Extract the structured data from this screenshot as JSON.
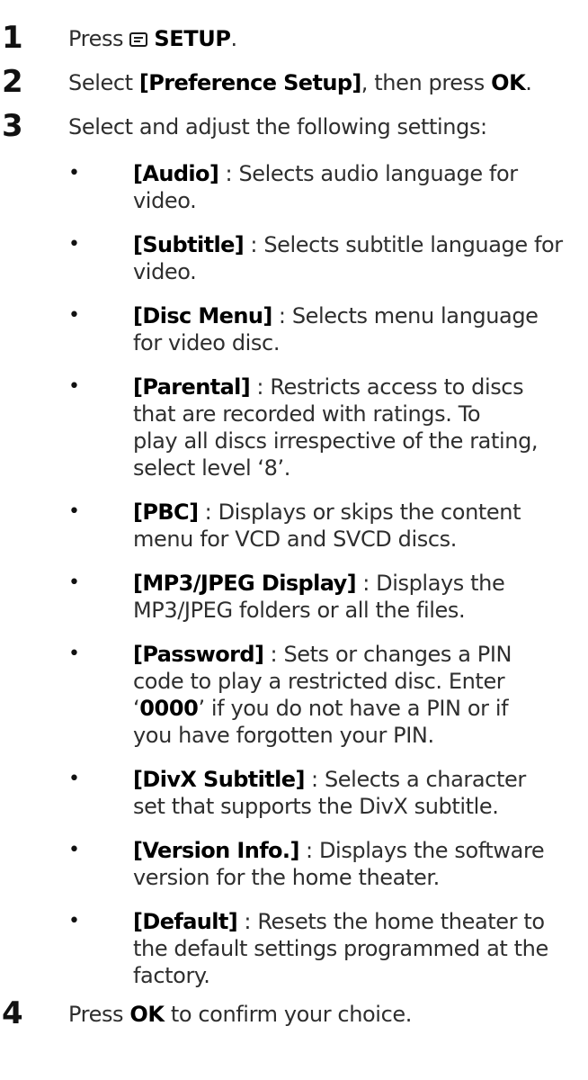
{
  "steps": [
    {
      "number": "1",
      "prefix": "Press ",
      "icon": "setup-menu-icon",
      "button": "SETUP",
      "suffix": "."
    },
    {
      "number": "2",
      "prefix": "Select ",
      "option": "[Preference Setup]",
      "middle": ", then press ",
      "button": "OK",
      "suffix": "."
    },
    {
      "number": "3",
      "text": "Select and adjust the following settings:"
    },
    {
      "number": "4",
      "prefix": "Press ",
      "button": "OK",
      "suffix": " to confirm your choice."
    }
  ],
  "settings": [
    {
      "name": "[Audio]",
      "lines": [
        " : Selects audio language for",
        "video."
      ]
    },
    {
      "name": "[Subtitle]",
      "lines": [
        " : Selects subtitle language for",
        "video."
      ]
    },
    {
      "name": "[Disc Menu]",
      "lines": [
        " : Selects menu language",
        "for video disc."
      ]
    },
    {
      "name": "[Parental]",
      "lines": [
        " : Restricts access to discs",
        "that are recorded with ratings. To",
        "play all discs irrespective of the rating,",
        "select level ‘8’."
      ]
    },
    {
      "name": "[PBC]",
      "lines": [
        " : Displays or skips the content",
        "menu for VCD and SVCD discs."
      ]
    },
    {
      "name": "[MP3/JPEG Display]",
      "lines": [
        " : Displays the",
        "MP3/JPEG folders or all the files."
      ]
    },
    {
      "name": "[Password]",
      "lines": [
        " : Sets or changes a PIN",
        "code to play a restricted disc. Enter"
      ],
      "code_prefix": "‘",
      "code": "0000",
      "code_suffix": "’ if you do not have a PIN or if",
      "last_line": "you have forgotten your PIN."
    },
    {
      "name": "[DivX Subtitle]",
      "lines": [
        " : Selects a character",
        "set that supports the DivX subtitle."
      ]
    },
    {
      "name": "[Version Info.]",
      "lines": [
        " : Displays the software",
        "version for the home theater."
      ]
    },
    {
      "name": "[Default]",
      "lines": [
        " : Resets the home theater to",
        "the default settings programmed at the",
        "factory."
      ]
    }
  ],
  "bullet_symbol": "•"
}
